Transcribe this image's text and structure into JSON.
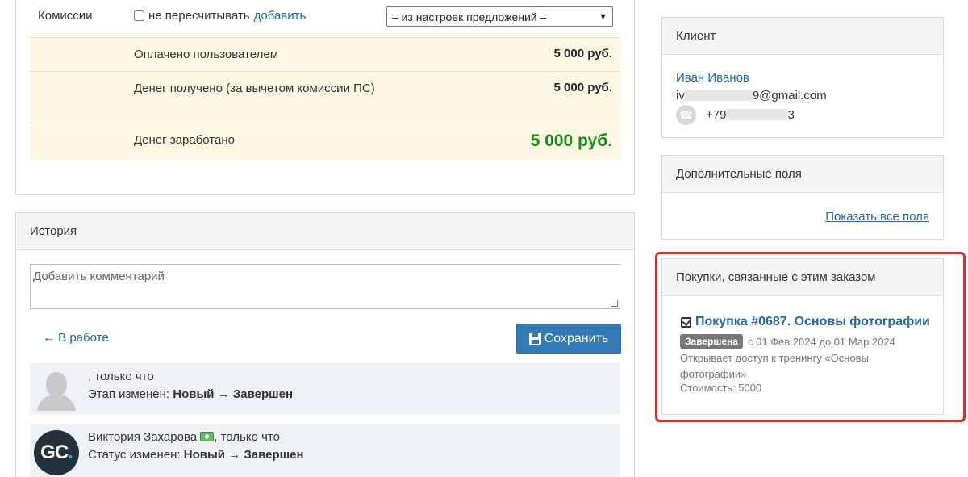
{
  "commissions": {
    "label": "Комиссии",
    "checkbox_label": "не пересчитывать",
    "add_link": "добавить",
    "select_value": "– из настроек предложений –"
  },
  "payments": [
    {
      "label": "Оплачено пользователем",
      "value": "5 000 руб."
    },
    {
      "label": "Денег получено (за вычетом комиссии ПС)",
      "value": "5 000 руб."
    },
    {
      "label": "Денег заработано",
      "value": "5 000 руб."
    }
  ],
  "history": {
    "title": "История",
    "comment_placeholder": "Добавить комментарий",
    "back_link": "← В работе",
    "save_label": "Сохранить",
    "items": [
      {
        "author": "",
        "time": ", только что",
        "prefix": "Этап изменен:",
        "from": "Новый",
        "arrow": "→",
        "to": "Завершен"
      },
      {
        "author": "Виктория Захарова",
        "time": ", только что",
        "avatar_text": "GC",
        "avatar_dot": ".",
        "prefix": "Статус изменен:",
        "from": "Новый",
        "arrow": "→",
        "to": "Завершен"
      }
    ]
  },
  "client": {
    "title": "Клиент",
    "name": "Иван Иванов",
    "email_start": "iv",
    "email_end": "9@gmail.com",
    "phone_start": "+79",
    "phone_end": "3"
  },
  "extra_fields": {
    "title": "Дополнительные поля",
    "show_all": "Показать все поля"
  },
  "related_purchases": {
    "title": "Покупки, связанные с этим заказом",
    "purchase_title": "Покупка #0687. Основы фотографии",
    "status": "Завершена",
    "period": "с 01 Фев 2024 до 01 Мар 2024",
    "description": "Открывает доступ к тренингу «Основы фотографии»",
    "cost": "Стоимость: 5000",
    "highlight_color": "#d9312f"
  }
}
